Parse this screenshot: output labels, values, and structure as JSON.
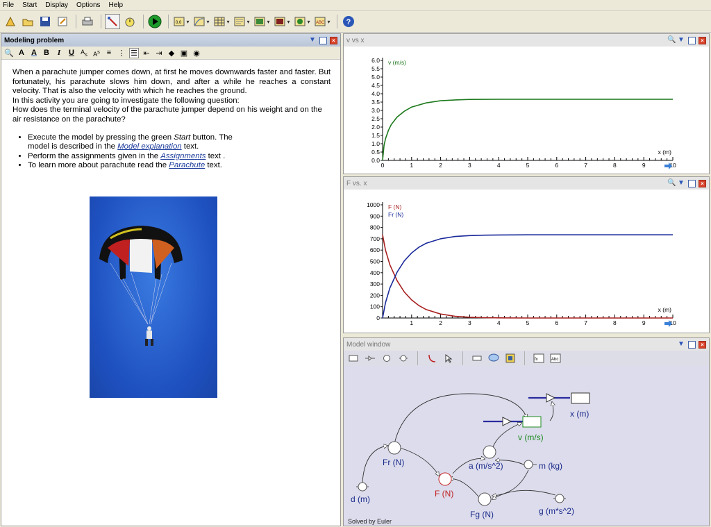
{
  "menu": [
    "File",
    "Start",
    "Display",
    "Options",
    "Help"
  ],
  "toolbar_icons": [
    "new-icon",
    "open-icon",
    "save-icon",
    "edit-icon",
    "print-icon",
    "tools-icon",
    "timer-icon",
    "start-icon",
    "meter-icon",
    "graph-icon",
    "table-icon",
    "notes-icon",
    "image-icon",
    "video-icon",
    "animation-icon",
    "text-icon",
    "help-icon"
  ],
  "left_panel": {
    "title": "Modeling problem",
    "paragraph": "When a parachute jumper comes down, at first he moves downwards faster and faster. But fortunately, his parachute slows him down, and after a while he reaches a constant velocity. That is also the velocity with which he reaches the ground.",
    "paragraph2": "In this activity you are going to investigate the following question:",
    "question": "How does the terminal velocity of the parachute jumper depend on his weight and on the air resistance on the parachute?",
    "bullets": [
      {
        "pre": "Execute the model by pressing the green ",
        "em": "Start",
        "post": " button. The model is described in the ",
        "link": "Model explanation",
        "post2": " text."
      },
      {
        "pre": "Perform the assignments given in the ",
        "link": "Assignments",
        "post": " text ."
      },
      {
        "pre": "To learn more about parachute read the ",
        "link": "Parachute",
        "post": " text."
      }
    ]
  },
  "graph1": {
    "title": "v vs x",
    "chart_data": {
      "type": "line",
      "ylabel": "v (m/s)",
      "xlabel": "x (m)",
      "xlim": [
        0,
        10
      ],
      "ylim": [
        0,
        6.0
      ],
      "yticks": [
        "0.0",
        "0.5",
        "1.0",
        "1.5",
        "2.0",
        "2.5",
        "3.0",
        "3.5",
        "4.0",
        "4.5",
        "5.0",
        "5.5",
        "6.0"
      ],
      "xticks": [
        "0",
        "1",
        "2",
        "3",
        "4",
        "5",
        "6",
        "7",
        "8",
        "9",
        "10"
      ],
      "series": [
        {
          "name": "v (m/s)",
          "color": "#1e7a1e",
          "x": [
            0,
            0.05,
            0.1,
            0.2,
            0.3,
            0.5,
            0.75,
            1,
            1.5,
            2,
            2.5,
            3,
            4,
            5,
            6,
            7,
            8,
            9,
            10
          ],
          "y": [
            0,
            0.9,
            1.3,
            1.8,
            2.15,
            2.6,
            2.95,
            3.2,
            3.45,
            3.58,
            3.63,
            3.66,
            3.67,
            3.67,
            3.67,
            3.67,
            3.67,
            3.67,
            3.67
          ]
        }
      ]
    }
  },
  "graph2": {
    "title": "F vs. x",
    "chart_data": {
      "type": "line",
      "xlabel": "x (m)",
      "xlim": [
        0,
        10
      ],
      "ylim": [
        0,
        1000
      ],
      "yticks": [
        "0",
        "100",
        "200",
        "300",
        "400",
        "500",
        "600",
        "700",
        "800",
        "900",
        "1000"
      ],
      "xticks": [
        "1",
        "2",
        "3",
        "4",
        "5",
        "6",
        "7",
        "8",
        "9",
        "10"
      ],
      "series": [
        {
          "name": "F (N)",
          "color": "#a82020",
          "x": [
            0,
            0.1,
            0.25,
            0.5,
            0.75,
            1,
            1.25,
            1.5,
            2,
            2.5,
            3,
            3.5,
            4,
            5,
            6,
            7,
            8,
            9,
            10
          ],
          "y": [
            735,
            600,
            470,
            330,
            230,
            160,
            110,
            75,
            35,
            15,
            7,
            3,
            1,
            0,
            0,
            0,
            0,
            0,
            0
          ]
        },
        {
          "name": "Fr (N)",
          "color": "#1a2a9a",
          "x": [
            0,
            0.1,
            0.25,
            0.5,
            0.75,
            1,
            1.25,
            1.5,
            2,
            2.5,
            3,
            3.5,
            4,
            5,
            6,
            7,
            8,
            9,
            10
          ],
          "y": [
            0,
            135,
            265,
            405,
            505,
            575,
            625,
            660,
            700,
            720,
            728,
            732,
            734,
            735,
            735,
            735,
            735,
            735,
            735
          ]
        }
      ]
    }
  },
  "model_window": {
    "title": "Model window",
    "status": "Solved by Euler",
    "nodes": {
      "x": "x (m)",
      "v": "v (m/s)",
      "a": "a (m/s^2)",
      "m": "m (kg)",
      "Fr": "Fr (N)",
      "F": "F (N)",
      "Fg": "Fg (N)",
      "d": "d (m)",
      "g": "g (m*s^2)"
    }
  },
  "colors": {
    "graph_v": "#1e7a1e",
    "graph_F": "#a82020",
    "graph_Fr": "#1a2a9a",
    "node_label": "#1a2a8a",
    "node_red": "#c02020",
    "node_green": "#1e8a1e"
  }
}
